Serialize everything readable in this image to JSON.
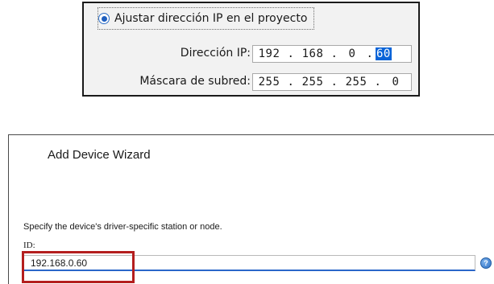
{
  "ip_panel": {
    "radio_label": "Ajustar dirección IP en el proyecto",
    "radio_selected": true,
    "ip_label": "Dirección IP:",
    "ip_segments": [
      "192",
      "168",
      "0",
      "60"
    ],
    "mask_label": "Máscara de subred:",
    "mask_segments": [
      "255",
      "255",
      "255",
      "0"
    ],
    "separator": "."
  },
  "wizard": {
    "title": "Add Device Wizard",
    "instructions": "Specify the device's driver-specific station or node.",
    "id_label": "ID:",
    "id_value": "192.168.0.60",
    "help_icon_glyph": "?"
  },
  "colors": {
    "selection": "#0a64d8",
    "highlight_border": "#b41e1e",
    "focus_underline": "#2a66c9"
  }
}
